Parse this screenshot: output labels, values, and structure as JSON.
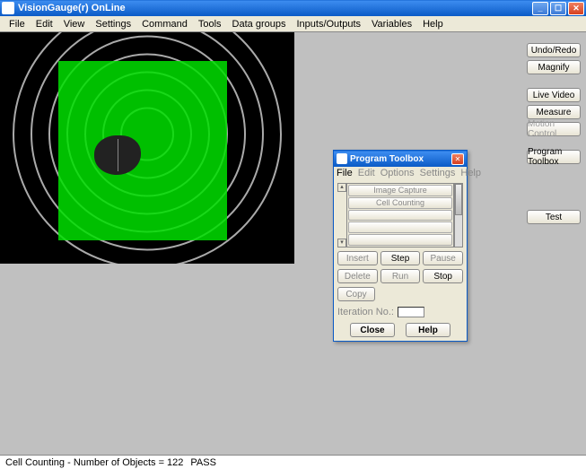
{
  "window": {
    "title": "VisionGauge(r) OnLine"
  },
  "menu": {
    "items": [
      "File",
      "Edit",
      "View",
      "Settings",
      "Command",
      "Tools",
      "Data groups",
      "Inputs/Outputs",
      "Variables",
      "Help"
    ]
  },
  "sidebar": {
    "undo": "Undo/Redo",
    "magnify": "Magnify",
    "livevideo": "Live Video",
    "measure": "Measure",
    "motion": "Motion Control",
    "program": "Program Toolbox",
    "test": "Test"
  },
  "toolbox": {
    "title": "Program Toolbox",
    "menu": {
      "file": "File",
      "edit": "Edit",
      "options": "Options",
      "settings": "Settings",
      "help": "Help"
    },
    "list": {
      "imageCapture": "Image Capture",
      "cellCounting": "Cell Counting"
    },
    "buttons": {
      "insert": "Insert",
      "step": "Step",
      "pause": "Pause",
      "delete": "Delete",
      "run": "Run",
      "stop": "Stop",
      "copy": "Copy",
      "close": "Close",
      "help": "Help"
    },
    "iteration_label": "Iteration No.:"
  },
  "status": {
    "text": "Cell Counting - Number of Objects = 122",
    "result": "PASS"
  }
}
